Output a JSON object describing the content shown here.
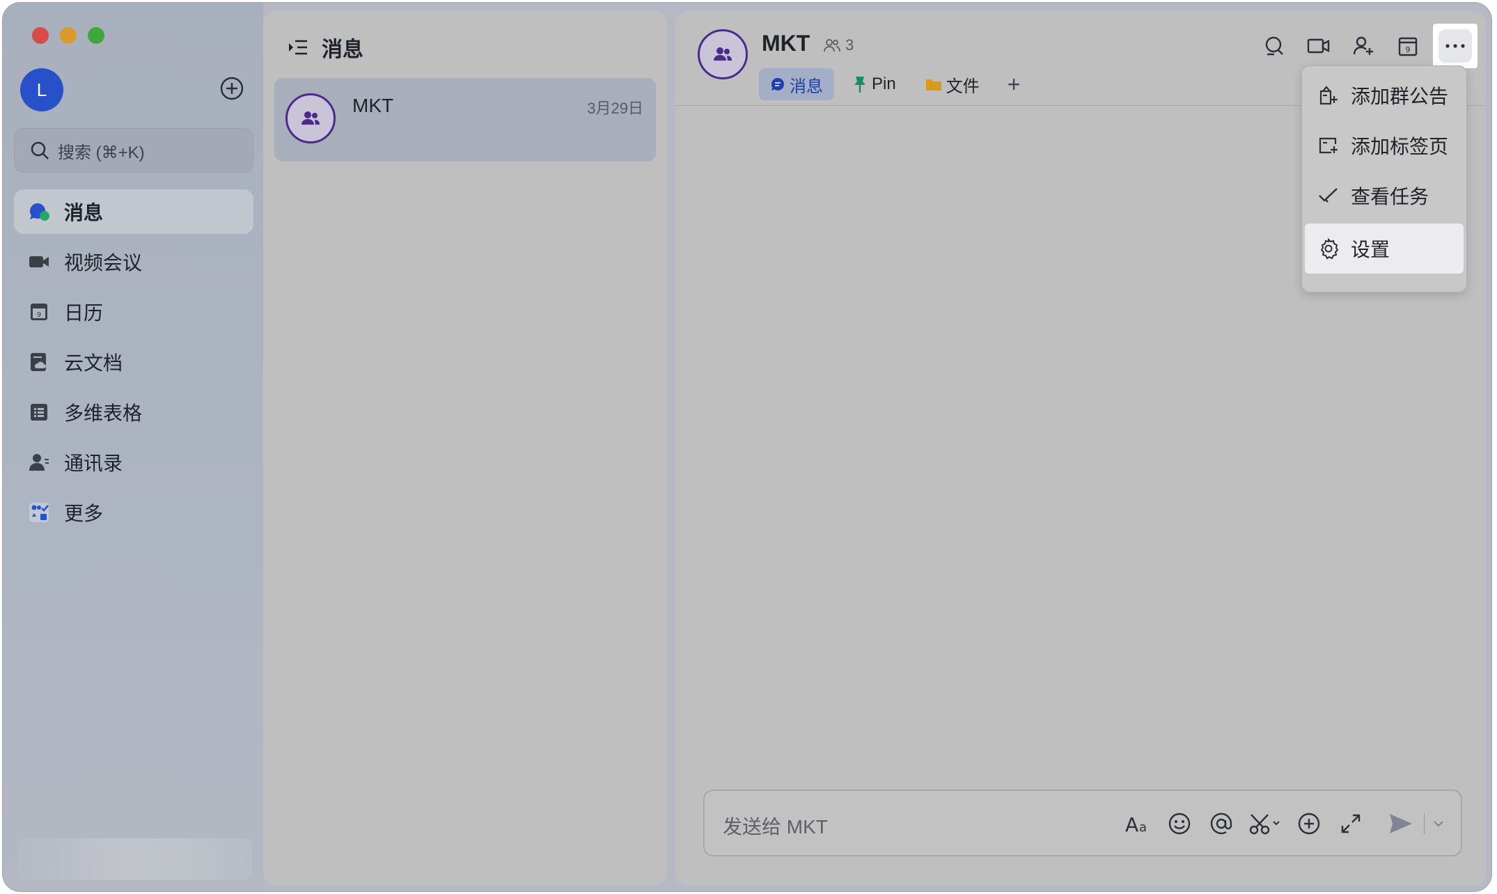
{
  "window": {
    "controls": [
      "close",
      "minimize",
      "maximize"
    ]
  },
  "sidebar": {
    "avatar_initial": "L",
    "new_icon": "plus-circle-icon",
    "search": {
      "placeholder": "搜索 (⌘+K)"
    },
    "items": [
      {
        "label": "消息",
        "icon": "chat-bubble-icon",
        "active": true
      },
      {
        "label": "视频会议",
        "icon": "video-camera-icon",
        "active": false
      },
      {
        "label": "日历",
        "icon": "calendar-icon",
        "active": false
      },
      {
        "label": "云文档",
        "icon": "cloud-doc-icon",
        "active": false
      },
      {
        "label": "多维表格",
        "icon": "table-icon",
        "active": false
      },
      {
        "label": "通讯录",
        "icon": "contacts-icon",
        "active": false
      },
      {
        "label": "更多",
        "icon": "apps-grid-icon",
        "active": false
      }
    ]
  },
  "chat_list": {
    "title": "消息",
    "chats": [
      {
        "name": "MKT",
        "date": "3月29日"
      }
    ]
  },
  "chat": {
    "title": "MKT",
    "member_count": "3",
    "tabs": [
      {
        "label": "消息",
        "icon": "chat-icon",
        "active": true
      },
      {
        "label": "Pin",
        "icon": "pin-icon",
        "active": false
      },
      {
        "label": "文件",
        "icon": "folder-icon",
        "active": false
      }
    ],
    "add_tab": "+",
    "header_actions": [
      "search-icon",
      "video-call-icon",
      "add-member-icon",
      "calendar-icon",
      "more-icon"
    ],
    "composer": {
      "placeholder": "发送给 MKT",
      "tools": [
        "font-format-icon",
        "emoji-icon",
        "mention-icon",
        "scissors-icon",
        "plus-icon",
        "expand-icon",
        "send-icon"
      ]
    }
  },
  "menu": {
    "items": [
      {
        "label": "添加群公告",
        "icon": "announcement-icon"
      },
      {
        "label": "添加标签页",
        "icon": "add-tab-icon"
      },
      {
        "label": "查看任务",
        "icon": "task-check-icon"
      },
      {
        "label": "设置",
        "icon": "gear-icon",
        "highlighted": true
      }
    ]
  },
  "colors": {
    "accent": "#2750c9",
    "group_avatar_border": "#4b2a8a",
    "active_tab_text": "#1e3fae"
  }
}
